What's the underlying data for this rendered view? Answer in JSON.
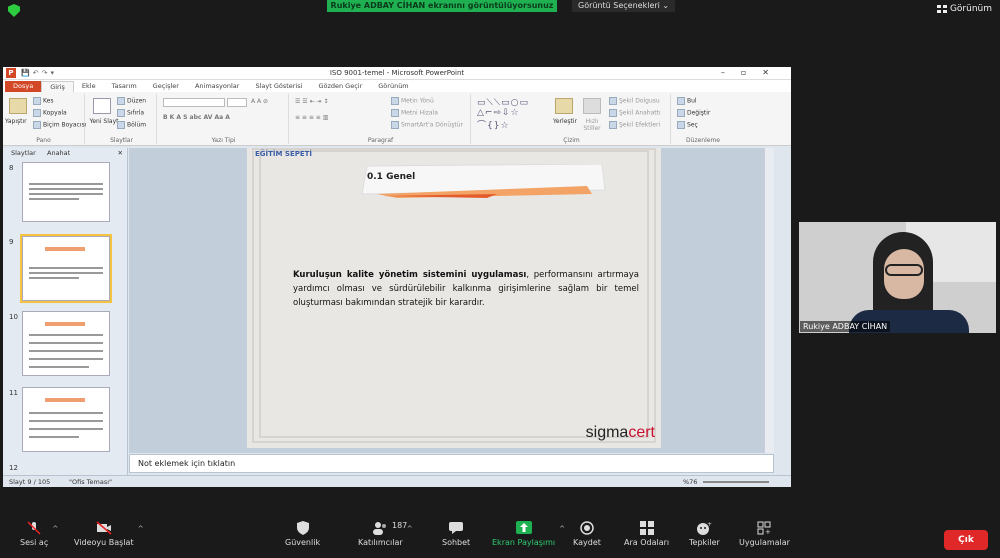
{
  "zoom": {
    "share_banner": "Rukiye ADBAY CİHAN ekranını görüntülüyorsunuz",
    "view_options": "Görüntü Seçenekleri ⌄",
    "view_button": "Görünüm",
    "participant_name": "Rukiye ADBAY CİHAN",
    "toolbar": {
      "audio": "Sesi aç",
      "video": "Videoyu Başlat",
      "security": "Güvenlik",
      "participants": "Katılımcılar",
      "participant_count": "187",
      "chat": "Sohbet",
      "share": "Ekran Paylaşımı",
      "record": "Kaydet",
      "breakout": "Ara Odaları",
      "reactions": "Tepkiler",
      "apps": "Uygulamalar",
      "leave": "Çık"
    },
    "colors": {
      "share_green": "#1fb151",
      "leave_red": "#e02828"
    }
  },
  "ppt": {
    "title": "ISO 9001-temel - Microsoft PowerPoint",
    "tabs": [
      "Dosya",
      "Giriş",
      "Ekle",
      "Tasarım",
      "Geçişler",
      "Animasyonlar",
      "Slayt Gösterisi",
      "Gözden Geçir",
      "Görünüm"
    ],
    "ribbon": {
      "clipboard": {
        "paste": "Yapıştır",
        "cut": "Kes",
        "copy": "Kopyala",
        "format_painter": "Biçim Boyacısı",
        "label": "Pano"
      },
      "slides": {
        "new_slide": "Yeni Slayt",
        "layout": "Düzen",
        "reset": "Sıfırla",
        "section": "Bölüm",
        "label": "Slaytlar"
      },
      "font": {
        "label": "Yazı Tipi"
      },
      "paragraph": {
        "text_direction": "Metin Yönü",
        "align_text": "Metni Hizala",
        "smartart": "SmartArt'a Dönüştür",
        "label": "Paragraf"
      },
      "drawing": {
        "arrange": "Yerleştir",
        "quick_styles": "Hızlı Stiller",
        "shape_fill": "Şekil Dolgusu",
        "shape_outline": "Şekil Anahattı",
        "shape_effects": "Şekil Efektleri",
        "label": "Çizim"
      },
      "editing": {
        "find": "Bul",
        "replace": "Değiştir",
        "select": "Seç",
        "label": "Düzenleme"
      }
    },
    "left_pane": {
      "tab_slides": "Slaytlar",
      "tab_outline": "Anahat",
      "thumb_numbers": [
        "8",
        "9",
        "10",
        "11",
        "12"
      ]
    },
    "slide": {
      "logo_text": "EĞİTİM SEPETİ",
      "banner": "0.1 Genel",
      "body_bold": "Kuruluşun kalite yönetim sistemini uygulaması",
      "body_rest": ", performansını artırmaya yardımcı olması ve sürdürülebilir kalkınma girişimlerine sağlam bir temel oluşturması bakımından stratejik bir karardır.",
      "brand_sigma": "sigma",
      "brand_cert": "cert"
    },
    "notes_placeholder": "Not eklemek için tıklatın",
    "status": {
      "slide_info": "Slayt 9 / 105",
      "theme": "\"Ofis Teması\"",
      "zoom": "%76"
    }
  }
}
